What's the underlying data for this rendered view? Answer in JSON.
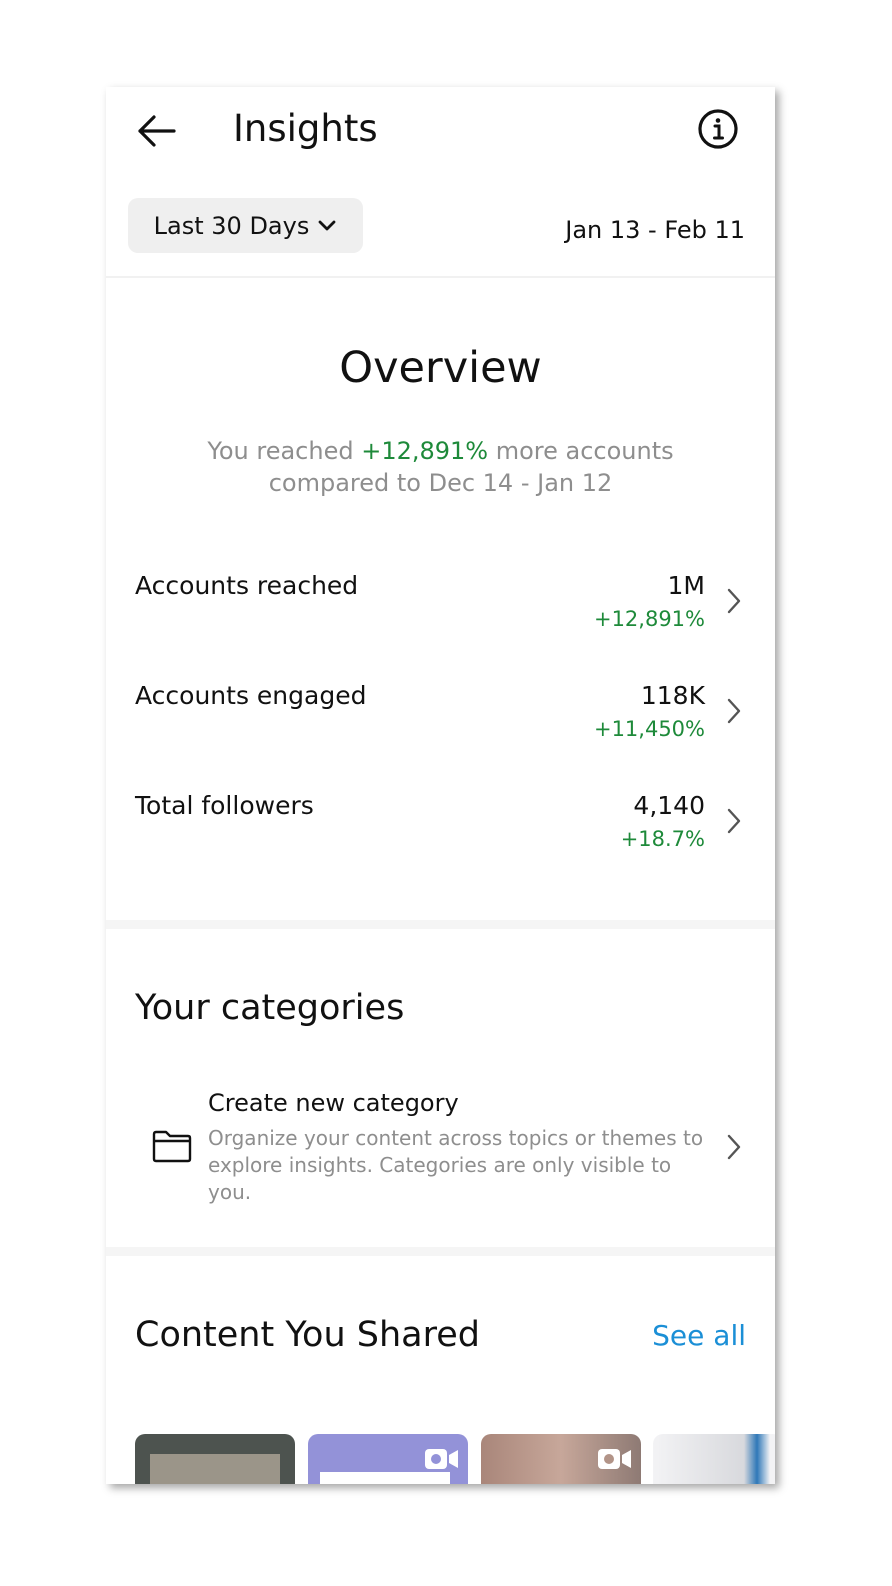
{
  "header": {
    "title": "Insights",
    "back_icon": "arrow-left-icon",
    "info_icon": "info-circle-icon"
  },
  "filter": {
    "range_label": "Last 30 Days",
    "date_range": "Jan 13 - Feb 11"
  },
  "overview": {
    "title": "Overview",
    "sub_prefix": "You reached ",
    "sub_highlight": "+12,891%",
    "sub_suffix": " more accounts",
    "sub_line2": "compared to Dec 14 - Jan 12",
    "metrics": [
      {
        "label": "Accounts reached",
        "value": "1M",
        "change": "+12,891%"
      },
      {
        "label": "Accounts engaged",
        "value": "118K",
        "change": "+11,450%"
      },
      {
        "label": "Total followers",
        "value": "4,140",
        "change": "+18.7%"
      }
    ]
  },
  "categories": {
    "title": "Your categories",
    "create_title": "Create new category",
    "create_desc": "Organize your content across topics or themes to explore insights. Categories are only visible to you.",
    "icon": "folder-icon"
  },
  "shared": {
    "title": "Content You Shared",
    "see_all": "See all"
  },
  "colors": {
    "positive": "#1e8a3a",
    "link": "#1b8fd6",
    "muted": "#8e8e8e"
  }
}
